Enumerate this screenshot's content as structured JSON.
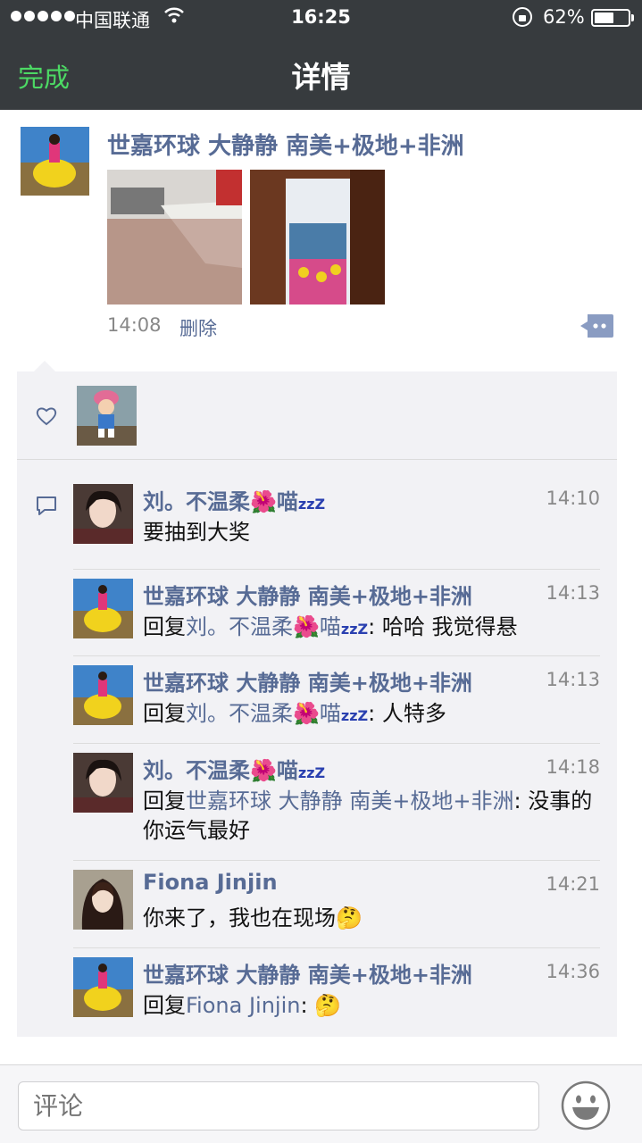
{
  "status_bar": {
    "carrier": "中国联通",
    "time": "16:25",
    "battery": "62%",
    "battery_level": 0.62
  },
  "nav": {
    "done": "完成",
    "title": "详情"
  },
  "post": {
    "author": "世嘉环球 大静静 南美+极地+非洲",
    "time": "14:08",
    "delete": "删除"
  },
  "comments": [
    {
      "name": "刘。不温柔🌺喵",
      "name_suffix": "zzZ",
      "time": "14:10",
      "text": "要抽到大奖"
    },
    {
      "name": "世嘉环球 大静静 南美+极地+非洲",
      "time": "14:13",
      "reply_prefix": "回复",
      "reply_to": "刘。不温柔🌺喵",
      "reply_suffix": "zzZ",
      "text": ": 哈哈 我觉得悬"
    },
    {
      "name": "世嘉环球 大静静 南美+极地+非洲",
      "time": "14:13",
      "reply_prefix": "回复",
      "reply_to": "刘。不温柔🌺喵",
      "reply_suffix": "zzZ",
      "text": ": 人特多"
    },
    {
      "name": "刘。不温柔🌺喵",
      "name_suffix": "zzZ",
      "time": "14:18",
      "reply_prefix": "回复",
      "reply_to": "世嘉环球 大静静 南美+极地+非洲",
      "text": ": 没事的 你运气最好"
    },
    {
      "name": "Fiona Jinjin",
      "time": "14:21",
      "text": "你来了，我也在现场🤔"
    },
    {
      "name": "世嘉环球 大静静 南美+极地+非洲",
      "time": "14:36",
      "reply_prefix": "回复",
      "reply_to": "Fiona Jinjin",
      "text": ": 🤔"
    }
  ],
  "input": {
    "placeholder": "评论"
  },
  "colors": {
    "bar": "#373b3e",
    "accent_green": "#4cd964",
    "name_blue": "#576b95",
    "panel": "#f2f2f5"
  }
}
